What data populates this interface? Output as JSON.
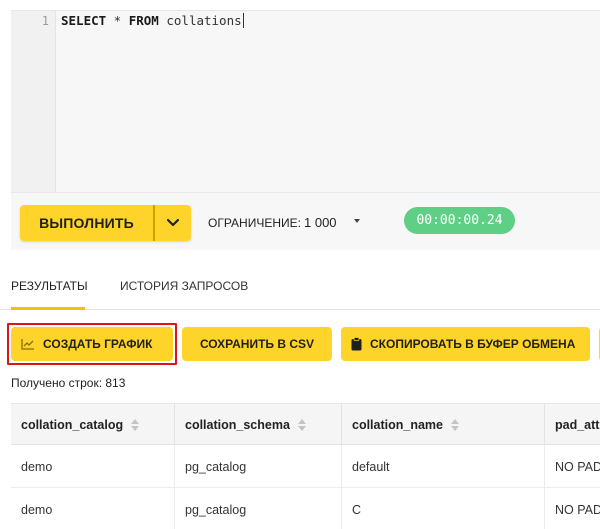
{
  "editor": {
    "line_number": "1",
    "code_keyword_1": "SELECT",
    "code_star": " * ",
    "code_keyword_2": "FROM",
    "code_rest": " collations"
  },
  "runbar": {
    "run_label": "ВЫПОЛНИТЬ",
    "limit_label": "ОГРАНИЧЕНИЕ:",
    "limit_value": "1 000",
    "timer": "00:00:00.24"
  },
  "tabs": {
    "results": "РЕЗУЛЬТАТЫ",
    "history": "ИСТОРИЯ ЗАПРОСОВ"
  },
  "actions": {
    "chart": "СОЗДАТЬ ГРАФИК",
    "csv": "СОХРАНИТЬ В CSV",
    "copy": "СКОПИРОВАТЬ В БУФЕР ОБМЕНА"
  },
  "rows_count": "Получено строк: 813",
  "table": {
    "columns": [
      "collation_catalog",
      "collation_schema",
      "collation_name",
      "pad_attr"
    ],
    "rows": [
      [
        "demo",
        "pg_catalog",
        "default",
        "NO PAD"
      ],
      [
        "demo",
        "pg_catalog",
        "C",
        "NO PAD"
      ]
    ]
  },
  "colors": {
    "accent": "#ffd42a",
    "timer_bg": "#5fcf85",
    "highlight_outline": "#e0121c"
  }
}
